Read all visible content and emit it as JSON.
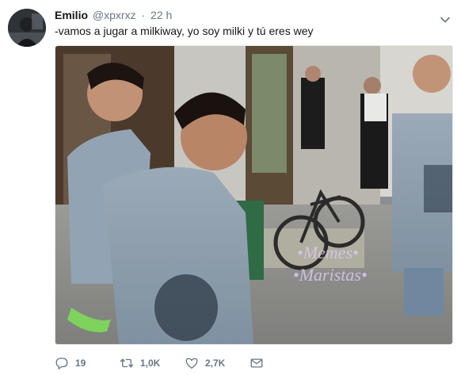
{
  "author": {
    "display_name": "Emilio",
    "handle": "@xpxrxz",
    "timestamp": "22 h"
  },
  "tweet": {
    "text": "-vamos a jugar a milkiway, yo soy milki y tú eres wey"
  },
  "media": {
    "watermark_line1": "•Memes•",
    "watermark_line2": "•Maristas•"
  },
  "actions": {
    "reply_count": "19",
    "retweet_count": "1,0K",
    "like_count": "2,7K",
    "icons": [
      "reply-icon",
      "retweet-icon",
      "like-icon",
      "direct-message-icon"
    ]
  },
  "colors": {
    "text_primary": "#14171a",
    "text_secondary": "#657786",
    "border": "#e1e8ed",
    "watermark": "#d8c8ef"
  }
}
